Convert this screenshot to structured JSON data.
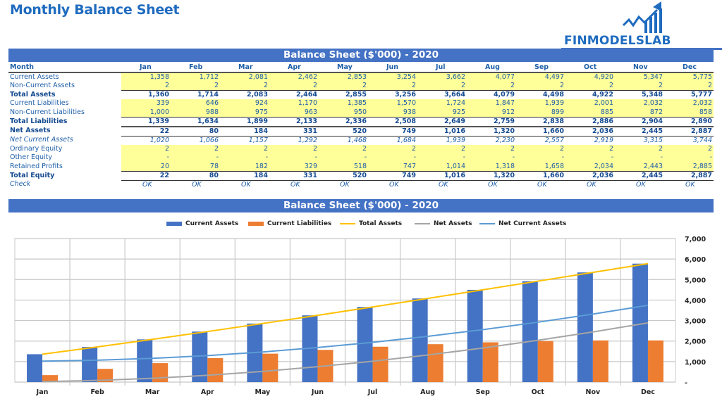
{
  "page": {
    "title": "Monthly Balance Sheet",
    "logo_text": "FINMODELSLAB"
  },
  "table": {
    "title": "Balance Sheet ($'000) - 2020",
    "header_label": "Month",
    "months": [
      "Jan",
      "Feb",
      "Mar",
      "Apr",
      "May",
      "Jun",
      "Jul",
      "Aug",
      "Sep",
      "Oct",
      "Nov",
      "Dec"
    ],
    "rows": [
      {
        "label": "Current Assets",
        "style": "yel",
        "values": [
          "1,358",
          "1,712",
          "2,081",
          "2,462",
          "2,853",
          "3,254",
          "3,662",
          "4,077",
          "4,497",
          "4,920",
          "5,347",
          "5,775"
        ]
      },
      {
        "label": "Non-Current Assets",
        "style": "yel ul",
        "values": [
          "2",
          "2",
          "2",
          "2",
          "2",
          "2",
          "2",
          "2",
          "2",
          "2",
          "2",
          "2"
        ]
      },
      {
        "label": "Total Assets",
        "style": "bold",
        "values": [
          "1,360",
          "1,714",
          "2,083",
          "2,464",
          "2,855",
          "3,256",
          "3,664",
          "4,079",
          "4,498",
          "4,922",
          "5,348",
          "5,777"
        ]
      },
      {
        "label": "Current Liabilities",
        "style": "yel",
        "values": [
          "339",
          "646",
          "924",
          "1,170",
          "1,385",
          "1,570",
          "1,724",
          "1,847",
          "1,939",
          "2,001",
          "2,032",
          "2,032"
        ]
      },
      {
        "label": "Non-Current Liabilities",
        "style": "yel ul",
        "values": [
          "1,000",
          "988",
          "975",
          "963",
          "950",
          "938",
          "925",
          "912",
          "899",
          "885",
          "872",
          "858"
        ]
      },
      {
        "label": "Total Liabilities",
        "style": "bold ul",
        "values": [
          "1,339",
          "1,634",
          "1,899",
          "2,133",
          "2,336",
          "2,508",
          "2,649",
          "2,759",
          "2,838",
          "2,886",
          "2,904",
          "2,890"
        ]
      },
      {
        "label": "Net Assets",
        "style": "bold tl ul",
        "values": [
          "22",
          "80",
          "184",
          "331",
          "520",
          "749",
          "1,016",
          "1,320",
          "1,660",
          "2,036",
          "2,445",
          "2,887"
        ]
      },
      {
        "label": "Net Current Assets",
        "style": "ital",
        "values": [
          "1,020",
          "1,066",
          "1,157",
          "1,292",
          "1,468",
          "1,684",
          "1,939",
          "2,230",
          "2,557",
          "2,919",
          "3,315",
          "3,744"
        ]
      },
      {
        "label": "Ordinary Equity",
        "style": "yel",
        "values": [
          "2",
          "2",
          "2",
          "2",
          "2",
          "2",
          "2",
          "2",
          "2",
          "2",
          "2",
          "2"
        ]
      },
      {
        "label": "Other Equity",
        "style": "yel",
        "values": [
          "-",
          "-",
          "-",
          "-",
          "-",
          "-",
          "-",
          "-",
          "-",
          "-",
          "-",
          "-"
        ]
      },
      {
        "label": "Retained Profits",
        "style": "yel ul",
        "values": [
          "20",
          "78",
          "182",
          "329",
          "518",
          "747",
          "1,014",
          "1,318",
          "1,658",
          "2,034",
          "2,443",
          "2,885"
        ]
      },
      {
        "label": "Total Equity",
        "style": "bold ul",
        "values": [
          "22",
          "80",
          "184",
          "331",
          "520",
          "749",
          "1,016",
          "1,320",
          "1,660",
          "2,036",
          "2,445",
          "2,887"
        ]
      },
      {
        "label": "Check",
        "style": "ital check",
        "values": [
          "OK",
          "OK",
          "OK",
          "OK",
          "OK",
          "OK",
          "OK",
          "OK",
          "OK",
          "OK",
          "OK",
          "OK"
        ]
      }
    ]
  },
  "chart_data": {
    "type": "bar",
    "title": "Balance Sheet ($'000) - 2020",
    "categories": [
      "Jan",
      "Feb",
      "Mar",
      "Apr",
      "May",
      "Jun",
      "Jul",
      "Aug",
      "Sep",
      "Oct",
      "Nov",
      "Dec"
    ],
    "series": [
      {
        "name": "Current Assets",
        "kind": "bar",
        "color": "#4472c4",
        "values": [
          1358,
          1712,
          2081,
          2462,
          2853,
          3254,
          3662,
          4077,
          4497,
          4920,
          5347,
          5775
        ]
      },
      {
        "name": "Current Liabilities",
        "kind": "bar",
        "color": "#ed7d31",
        "values": [
          339,
          646,
          924,
          1170,
          1385,
          1570,
          1724,
          1847,
          1939,
          2001,
          2032,
          2032
        ]
      },
      {
        "name": "Total Assets",
        "kind": "line",
        "color": "#ffc000",
        "values": [
          1360,
          1714,
          2083,
          2464,
          2855,
          3256,
          3664,
          4079,
          4498,
          4922,
          5348,
          5777
        ]
      },
      {
        "name": "Net Assets",
        "kind": "line",
        "color": "#a5a5a5",
        "values": [
          22,
          80,
          184,
          331,
          520,
          749,
          1016,
          1320,
          1660,
          2036,
          2445,
          2887
        ]
      },
      {
        "name": "Net Current Assets",
        "kind": "line",
        "color": "#5b9bd5",
        "values": [
          1020,
          1066,
          1157,
          1292,
          1468,
          1684,
          1939,
          2230,
          2557,
          2919,
          3315,
          3744
        ]
      }
    ],
    "ylim": [
      0,
      7000
    ],
    "yticks": [
      0,
      1000,
      2000,
      3000,
      4000,
      5000,
      6000,
      7000
    ],
    "ytick_labels": [
      "-",
      "1,000",
      "2,000",
      "3,000",
      "4,000",
      "5,000",
      "6,000",
      "7,000"
    ],
    "y_axis_side": "right",
    "grid": true,
    "legend": "top-center",
    "xlabel": "",
    "ylabel": ""
  }
}
